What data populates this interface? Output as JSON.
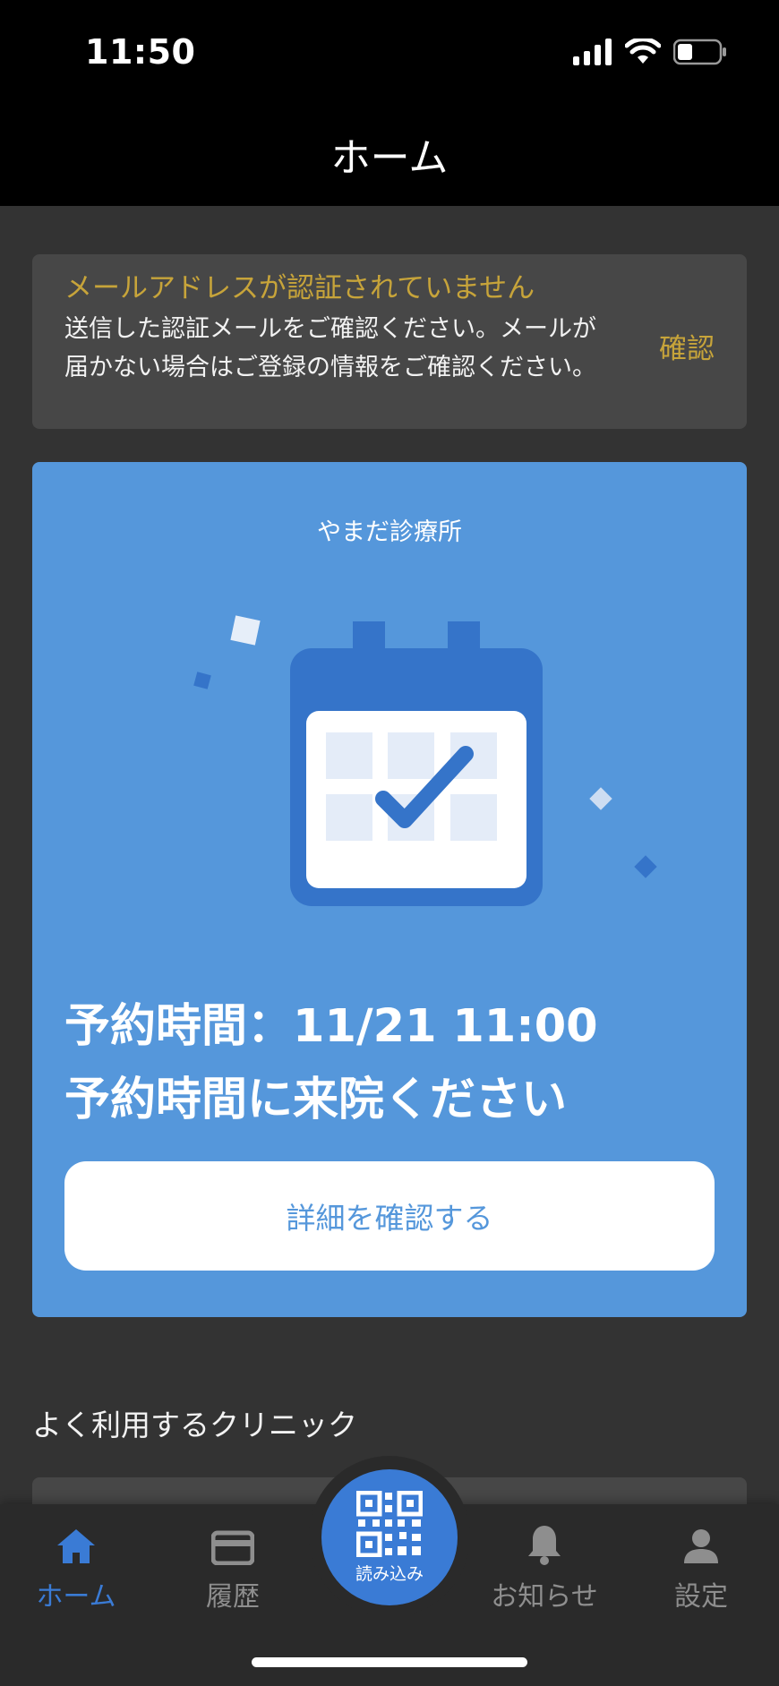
{
  "status_bar": {
    "time": "11:50"
  },
  "header": {
    "title": "ホーム"
  },
  "email_warning": {
    "title": "メールアドレスが認証されていません",
    "body": "送信した認証メールをご確認ください。メールが届かない場合はご登録の情報をご確認ください。",
    "confirm_label": "確認",
    "accent_color": "#c7a43a"
  },
  "appointment": {
    "clinic_name": "やまだ診療所",
    "time_line": "予約時間：11/21 11:00",
    "message": "予約時間に来院ください",
    "detail_button_label": "詳細を確認する",
    "card_color": "#5597db",
    "illustration_icon": "calendar-check-icon"
  },
  "favorites": {
    "title": "よく利用するクリニック"
  },
  "tabbar": {
    "tabs": [
      {
        "label": "ホーム",
        "icon": "home-icon",
        "active": true
      },
      {
        "label": "履歴",
        "icon": "card-icon",
        "active": false
      },
      {
        "label": "読み込み",
        "icon": "qr-code-icon",
        "active": false
      },
      {
        "label": "お知らせ",
        "icon": "bell-icon",
        "active": false
      },
      {
        "label": "設定",
        "icon": "person-icon",
        "active": false
      }
    ],
    "active_color": "#3a7bd5",
    "inactive_color": "#8e8e8e"
  }
}
